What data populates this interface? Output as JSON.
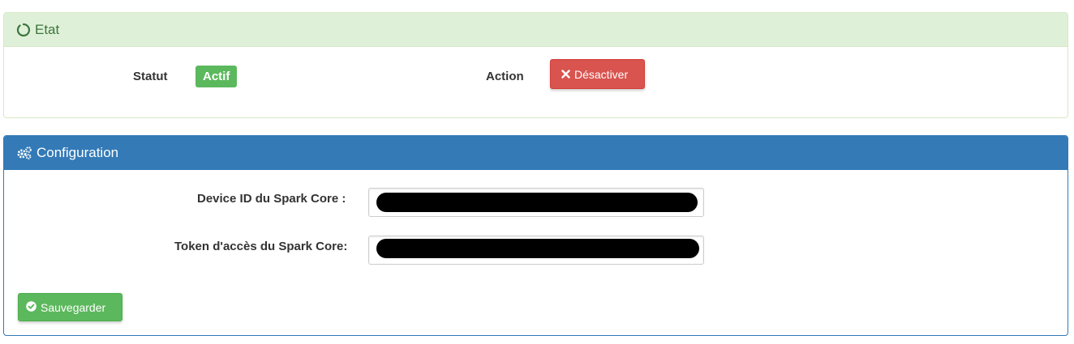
{
  "etat": {
    "title": "Etat",
    "statut_label": "Statut",
    "statut_value": "Actif",
    "action_label": "Action",
    "deactivate_label": "Désactiver"
  },
  "config": {
    "title": "Configuration",
    "device_id_label": "Device ID du Spark Core :",
    "device_id_value": "",
    "token_label": "Token d'accès du Spark Core:",
    "token_value": "",
    "save_label": "Sauvegarder"
  },
  "colors": {
    "success": "#5cb85c",
    "danger": "#d9534f",
    "primary": "#337ab7",
    "success_light": "#dff0d8"
  },
  "icons": {
    "etat": "circle-notch-icon",
    "config": "cogs-icon",
    "deactivate": "times-icon",
    "save": "check-circle-icon"
  }
}
